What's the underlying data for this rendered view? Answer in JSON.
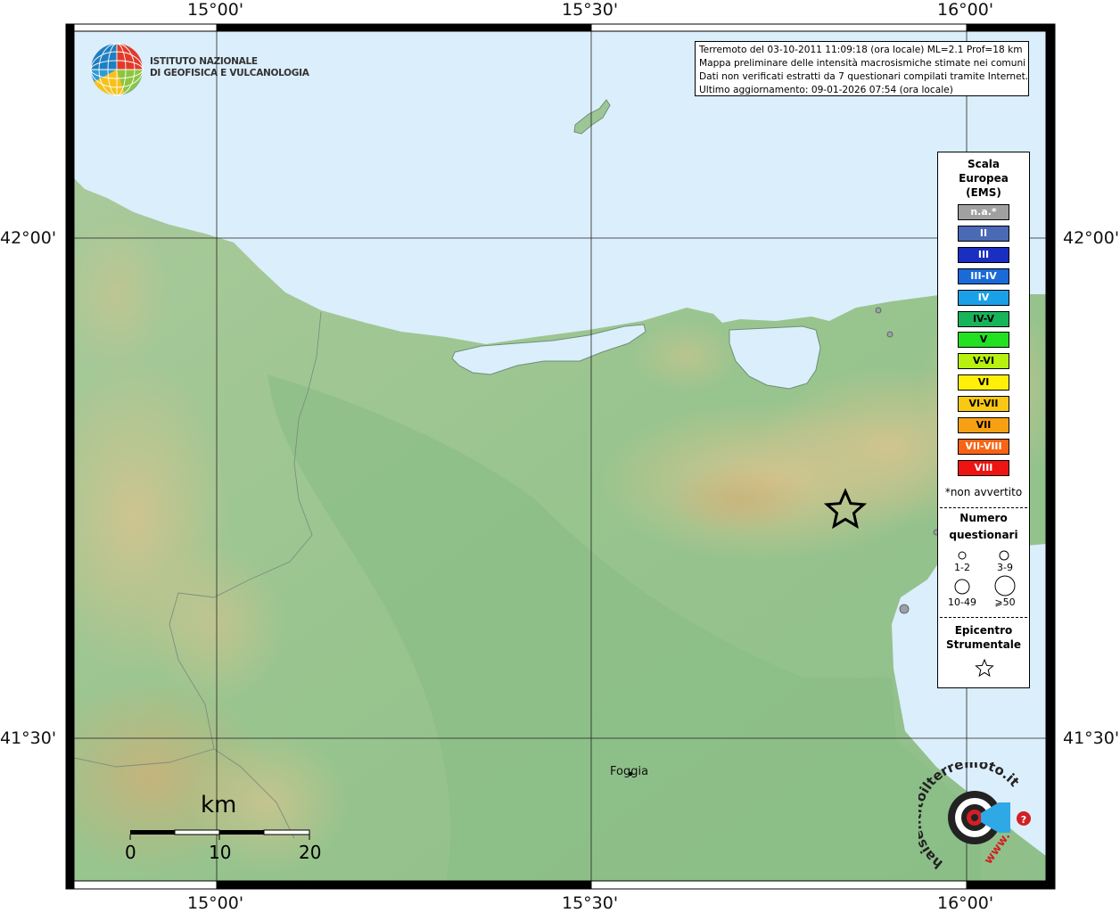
{
  "map": {
    "lon_labels": [
      "15°00'",
      "15°30'",
      "16°00'"
    ],
    "lat_labels": [
      "42°00'",
      "41°30'"
    ],
    "city": "Foggia"
  },
  "info_box": {
    "line1": "Terremoto del 03-10-2011 11:09:18 (ora locale) ML=2.1 Prof=18 km",
    "line2": "Mappa preliminare delle intensità macrosismiche stimate nei comuni",
    "line3": "Dati non verificati estratti da 7 questionari compilati tramite Internet.",
    "line4": "Ultimo aggiornamento: 09-01-2026 07:54 (ora locale)"
  },
  "ingv_logo": {
    "line1": "ISTITUTO NAZIONALE",
    "line2": "DI GEOFISICA E VULCANOLOGIA"
  },
  "legend": {
    "title1": "Scala",
    "title2": "Europea",
    "title3": "(EMS)",
    "classes": [
      {
        "label": "n.a.*",
        "color": "#a0a0a0",
        "text": "#ffffff"
      },
      {
        "label": "II",
        "color": "#4a6ab5",
        "text": "#ffffff"
      },
      {
        "label": "III",
        "color": "#1a2ec0",
        "text": "#ffffff"
      },
      {
        "label": "III-IV",
        "color": "#1a6ad8",
        "text": "#ffffff"
      },
      {
        "label": "IV",
        "color": "#1aa0e8",
        "text": "#ffffff"
      },
      {
        "label": "IV-V",
        "color": "#17b45a",
        "text": "#000000"
      },
      {
        "label": "V",
        "color": "#22e022",
        "text": "#000000"
      },
      {
        "label": "V-VI",
        "color": "#b8f010",
        "text": "#000000"
      },
      {
        "label": "VI",
        "color": "#fff00a",
        "text": "#000000"
      },
      {
        "label": "VI-VII",
        "color": "#f8c814",
        "text": "#000000"
      },
      {
        "label": "VII",
        "color": "#f8a014",
        "text": "#000000"
      },
      {
        "label": "VII-VIII",
        "color": "#f86414",
        "text": "#ffffff"
      },
      {
        "label": "VIII",
        "color": "#ee1414",
        "text": "#ffffff"
      }
    ],
    "not_felt_note": "*non avvertito",
    "questionnaires_title1": "Numero",
    "questionnaires_title2": "questionari",
    "q_labels": [
      "1-2",
      "3-9",
      "10-49",
      "⩾50"
    ],
    "epicenter_title1": "Epicentro",
    "epicenter_title2": "Strumentale"
  },
  "scale_bar": {
    "unit": "km",
    "ticks": [
      "0",
      "10",
      "20"
    ]
  },
  "hsn_logo": {
    "text": "haisentitoilterremoto.it",
    "www": "www."
  }
}
